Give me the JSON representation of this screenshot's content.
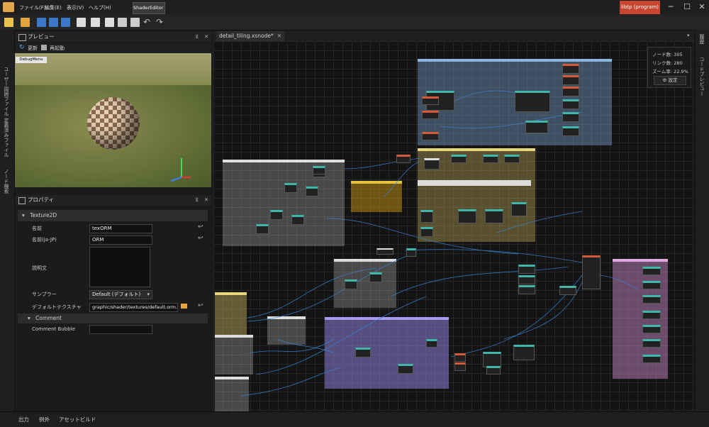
{
  "titlebar": {
    "menus": [
      "ファイル(F)",
      "編集(E)",
      "表示(V)",
      "ヘルプ(H)"
    ],
    "app_tab": "ShaderEditor (開発中)",
    "program_button": "libtp (program)"
  },
  "left_sidebar": {
    "tabs": [
      "ユーザー周囲ファイル",
      "定義済みファイル",
      "ノード検索"
    ]
  },
  "right_sidebar": {
    "tabs": [
      "履歴",
      "コードプレビュー"
    ]
  },
  "preview": {
    "title": "プレビュー",
    "refresh": "更新",
    "restart": "再起動",
    "debug_menu": "DebugMenu"
  },
  "properties": {
    "title": "プロパティ",
    "section": "Texture2D",
    "rows": [
      {
        "label": "名前",
        "value": "texORM"
      },
      {
        "label": "名前(ja-JP)",
        "value": "ORM"
      },
      {
        "label": "説明文",
        "value": ""
      },
      {
        "label": "サンプラー",
        "value": "Default (デフォルト)"
      },
      {
        "label": "デフォルトテクスチャ",
        "value": "graphic/shader/textures/default.orm.tga"
      }
    ],
    "comment_section": "Comment",
    "comment_label": "Comment Bubble"
  },
  "editor": {
    "tab": "detail_tiling.xsnode*",
    "stats": {
      "node_label": "ノード数",
      "node_count": "305",
      "link_label": "リンク数",
      "link_count": "280",
      "zoom_label": "ズーム率",
      "zoom": "22.9%",
      "settings": "設定"
    }
  },
  "statusbar": {
    "items": [
      "出力",
      "例外",
      "アセットビルド"
    ]
  },
  "colors": {
    "accent": "#c8452f",
    "group_blue": "#7fa9d6",
    "group_yellow": "#e9d57a",
    "group_purple": "#8a7ed6",
    "group_pink": "#c98ac9",
    "node_orange": "#d45a38",
    "node_teal": "#3fb6a8"
  }
}
